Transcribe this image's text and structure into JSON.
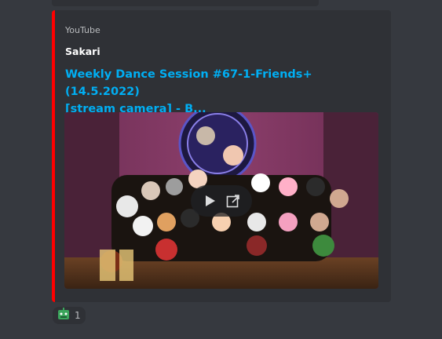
{
  "embed": {
    "provider": "YouTube",
    "author": "Sakari",
    "title_line1": "Weekly Dance Session #67-1-Friends+ (14.5.2022)",
    "title_line2": "[stream camera] - B...",
    "accent_color": "#ff0000",
    "thumbnail": {
      "icon": "video-thumbnail-group-photo",
      "play_icon": "play-icon",
      "external_icon": "open-external-icon"
    }
  },
  "reaction": {
    "emoji_icon": "robot-emoji-icon",
    "count": "1"
  }
}
